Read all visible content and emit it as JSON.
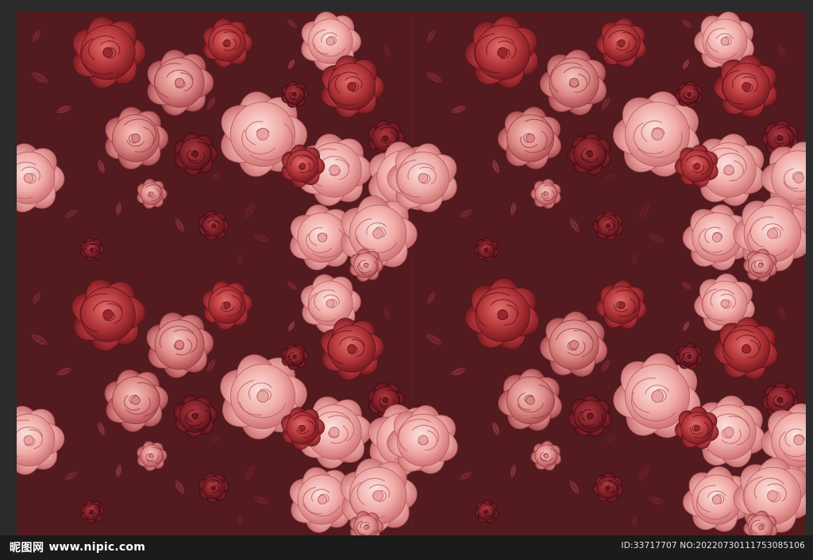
{
  "image": {
    "subject": "seamless-floral-rose-pattern",
    "background_color": "#531a1f",
    "palette": [
      "#f3b7b2",
      "#df8b86",
      "#b7363b",
      "#8e1f26",
      "#5b171d",
      "#e9a0a0"
    ]
  },
  "watermark": {
    "site_name": "昵图网",
    "site_url": "www.nipic.com",
    "image_id_text": "ID:33717707 NO:20220730111753085106"
  }
}
